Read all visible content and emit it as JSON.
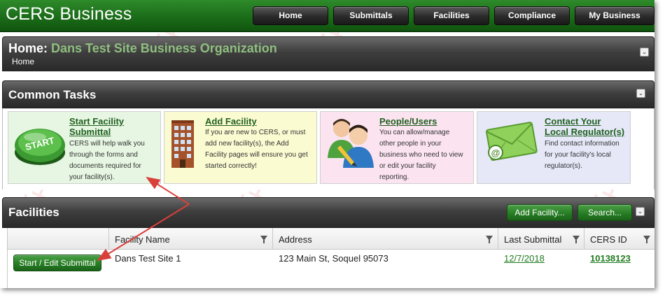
{
  "app": {
    "brand": "CERS Business"
  },
  "nav": {
    "items": [
      {
        "label": "Home"
      },
      {
        "label": "Submittals"
      },
      {
        "label": "Facilities"
      },
      {
        "label": "Compliance"
      },
      {
        "label": "My Business"
      }
    ]
  },
  "home": {
    "title_prefix": "Home:",
    "org_name": "Dans Test Site Business Organization",
    "breadcrumb": "Home"
  },
  "common_tasks": {
    "title": "Common Tasks",
    "tiles": [
      {
        "link_line1": "Start Facility",
        "link_line2": "Submittal",
        "desc": [
          "CERS will help walk you",
          "through the forms and",
          "documents required for",
          "your facility(s)."
        ],
        "icon_text": "START",
        "bg": "#e6f6e2"
      },
      {
        "link_line1": "Add Facility",
        "desc": [
          "If you are new to CERS, or must",
          "add new facility(s), the Add",
          "Facility pages will ensure you get",
          "started correctly!"
        ],
        "bg": "#fbfbd2"
      },
      {
        "link_line1": "People/Users",
        "desc": [
          "You can allow/manage",
          "other people in your",
          "business who need to view",
          "or edit your facility",
          "reporting."
        ],
        "bg": "#fbe3f0"
      },
      {
        "link_line1": "Contact Your",
        "link_line2": "Local Regulator(s)",
        "desc": [
          "Find contact information",
          "for your facility's local",
          "regulator(s)."
        ],
        "bg": "#e6e8f8"
      }
    ]
  },
  "facilities": {
    "title": "Facilities",
    "add_button": "Add Facility...",
    "search_button": "Search...",
    "columns": [
      "Facility Name",
      "Address",
      "Last Submittal",
      "CERS ID"
    ],
    "rows": [
      {
        "action": "Start / Edit Submittal",
        "facility_name": "Dans Test Site 1",
        "address": "123 Main St, Soquel 95073",
        "last_submittal": "12/7/2018",
        "cers_id": "10138123"
      }
    ]
  },
  "colors": {
    "brand_green": "#1a6a18",
    "link_green": "#1f5f1f",
    "org_green": "#8fbf7f",
    "annotation_red": "#d9403a"
  }
}
